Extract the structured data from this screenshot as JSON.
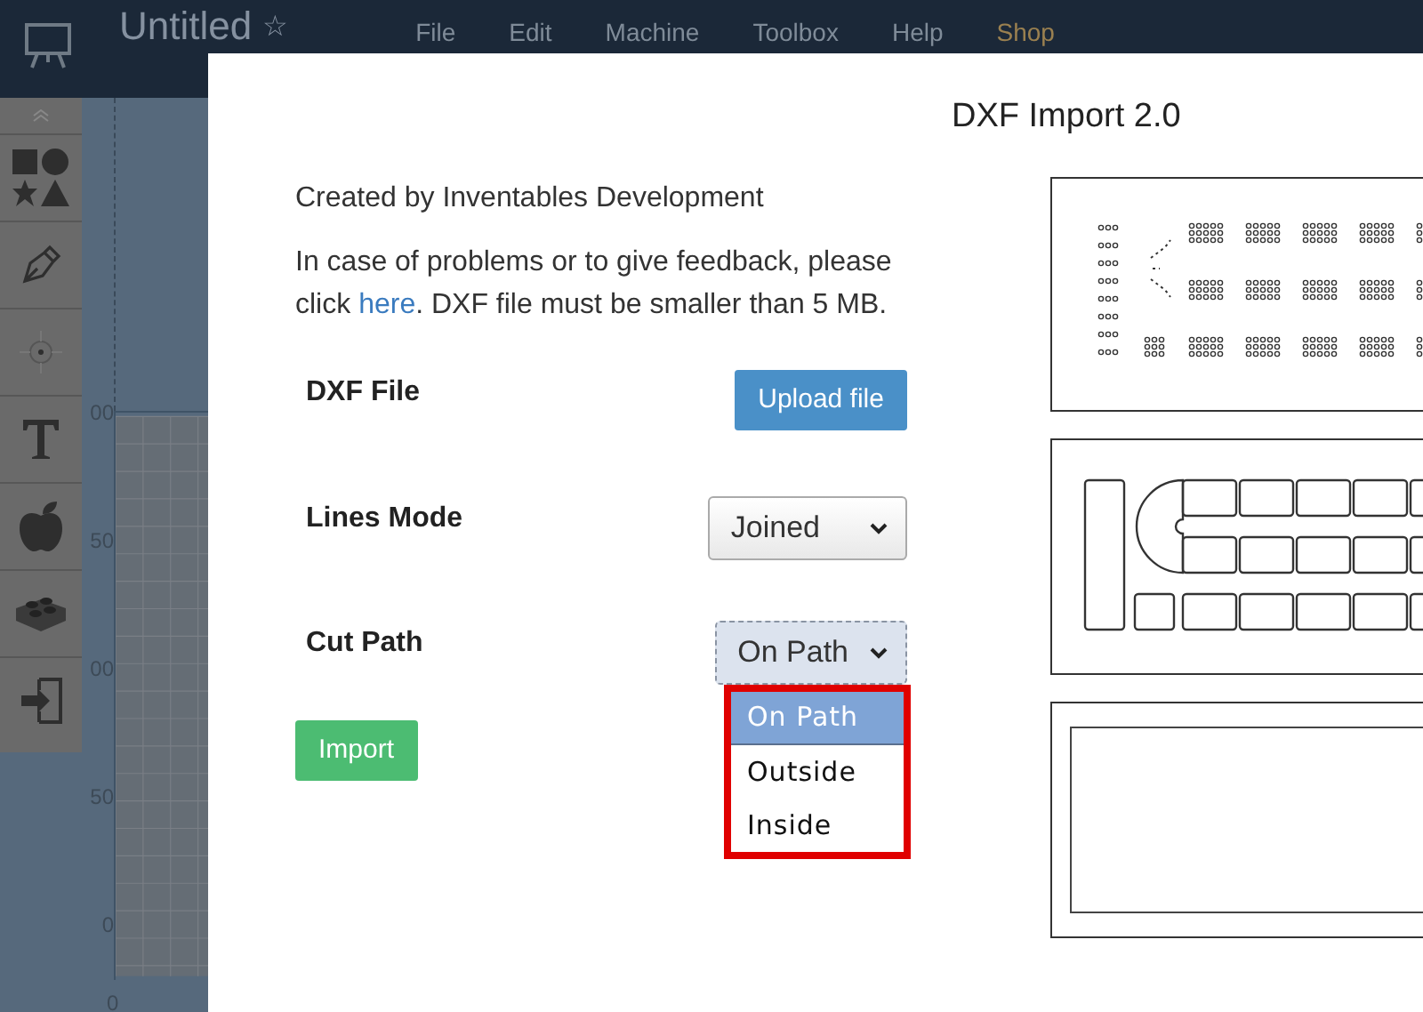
{
  "app": {
    "title": "Untitled",
    "star": "☆",
    "menu": [
      {
        "label": "File",
        "kind": "menu"
      },
      {
        "label": "Edit",
        "kind": "menu"
      },
      {
        "label": "Machine",
        "kind": "menu"
      },
      {
        "label": "Toolbox",
        "kind": "menu"
      },
      {
        "label": "Help",
        "kind": "menu"
      },
      {
        "label": "Shop",
        "kind": "shop"
      }
    ]
  },
  "canvas": {
    "y_labels": [
      "00",
      "50",
      "00",
      "50",
      "0"
    ],
    "x_label": "0"
  },
  "dialog": {
    "title": "DXF Import 2.0",
    "credit": "Created by Inventables Development",
    "help_before": "In case of problems or to give feedback, please click ",
    "help_link": "here",
    "help_after": ". DXF file must be smaller than 5 MB.",
    "fields": [
      {
        "label": "DXF File",
        "kind": "upload",
        "button": "Upload file"
      },
      {
        "label": "Lines Mode",
        "kind": "select",
        "value": "Joined",
        "open": false
      },
      {
        "label": "Cut Path",
        "kind": "select",
        "value": "On Path",
        "open": true,
        "options": [
          {
            "label": "On Path",
            "selected": true
          },
          {
            "label": "Outside",
            "selected": false
          },
          {
            "label": "Inside",
            "selected": false
          }
        ]
      }
    ],
    "import_button": "Import"
  }
}
